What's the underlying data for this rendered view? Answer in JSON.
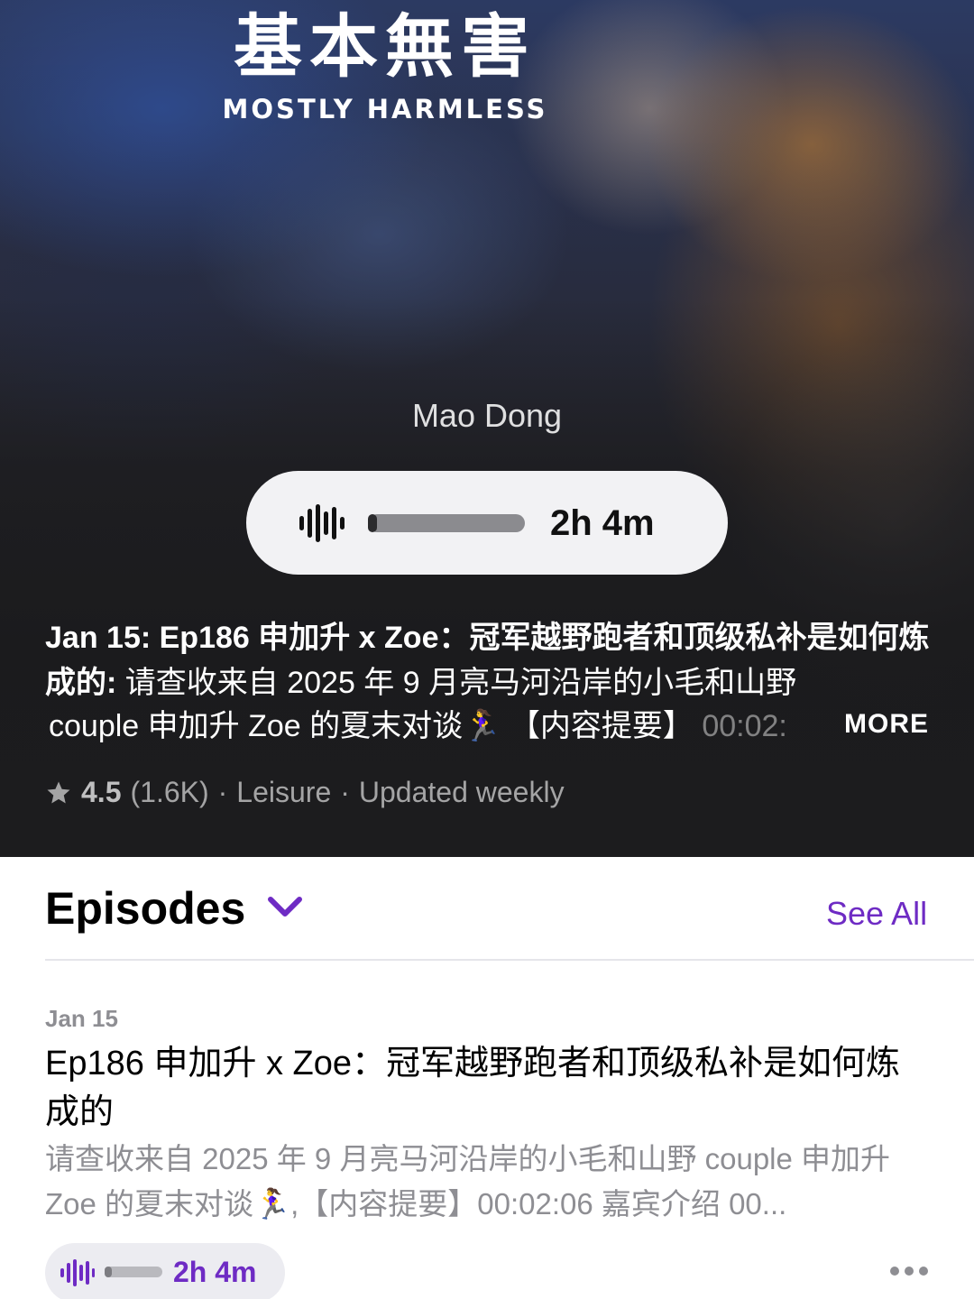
{
  "podcast": {
    "artwork_title": "基本無害",
    "artwork_subtitle": "MOSTLY HARMLESS",
    "author": "Mao Dong"
  },
  "player": {
    "icon": "waveform-icon",
    "progress": 0.02,
    "duration": "2h 4m"
  },
  "latest": {
    "lead": "Jan 15: Ep186 申加升 x Zoe：冠军越野跑者和顶级私补是如何炼成的:",
    "rest": " 请查收来自 2025 年 9 月亮马河沿岸的小毛和山野",
    "line3": "couple 申加升 Zoe 的夏末对谈🏃‍♀️ 【内容提要】",
    "line3_faded": " 00:02:",
    "more_label": "MORE"
  },
  "meta": {
    "rating": "4.5",
    "rating_count": "(1.6K)",
    "sep1": "·",
    "category": "Leisure",
    "sep2": "·",
    "frequency": "Updated weekly"
  },
  "episodes": {
    "title": "Episodes",
    "see_all": "See All",
    "accent_color": "#6e2bc4",
    "items": [
      {
        "date": "Jan 15",
        "title": "Ep186 申加升 x Zoe：冠军越野跑者和顶级私补是如何炼成的",
        "description": "请查收来自 2025 年 9 月亮马河沿岸的小毛和山野 couple 申加升 Zoe 的夏末对谈🏃‍♀️,【内容提要】00:02:06 嘉宾介绍 00...",
        "duration": "2h 4m",
        "progress": 0.05
      }
    ]
  }
}
